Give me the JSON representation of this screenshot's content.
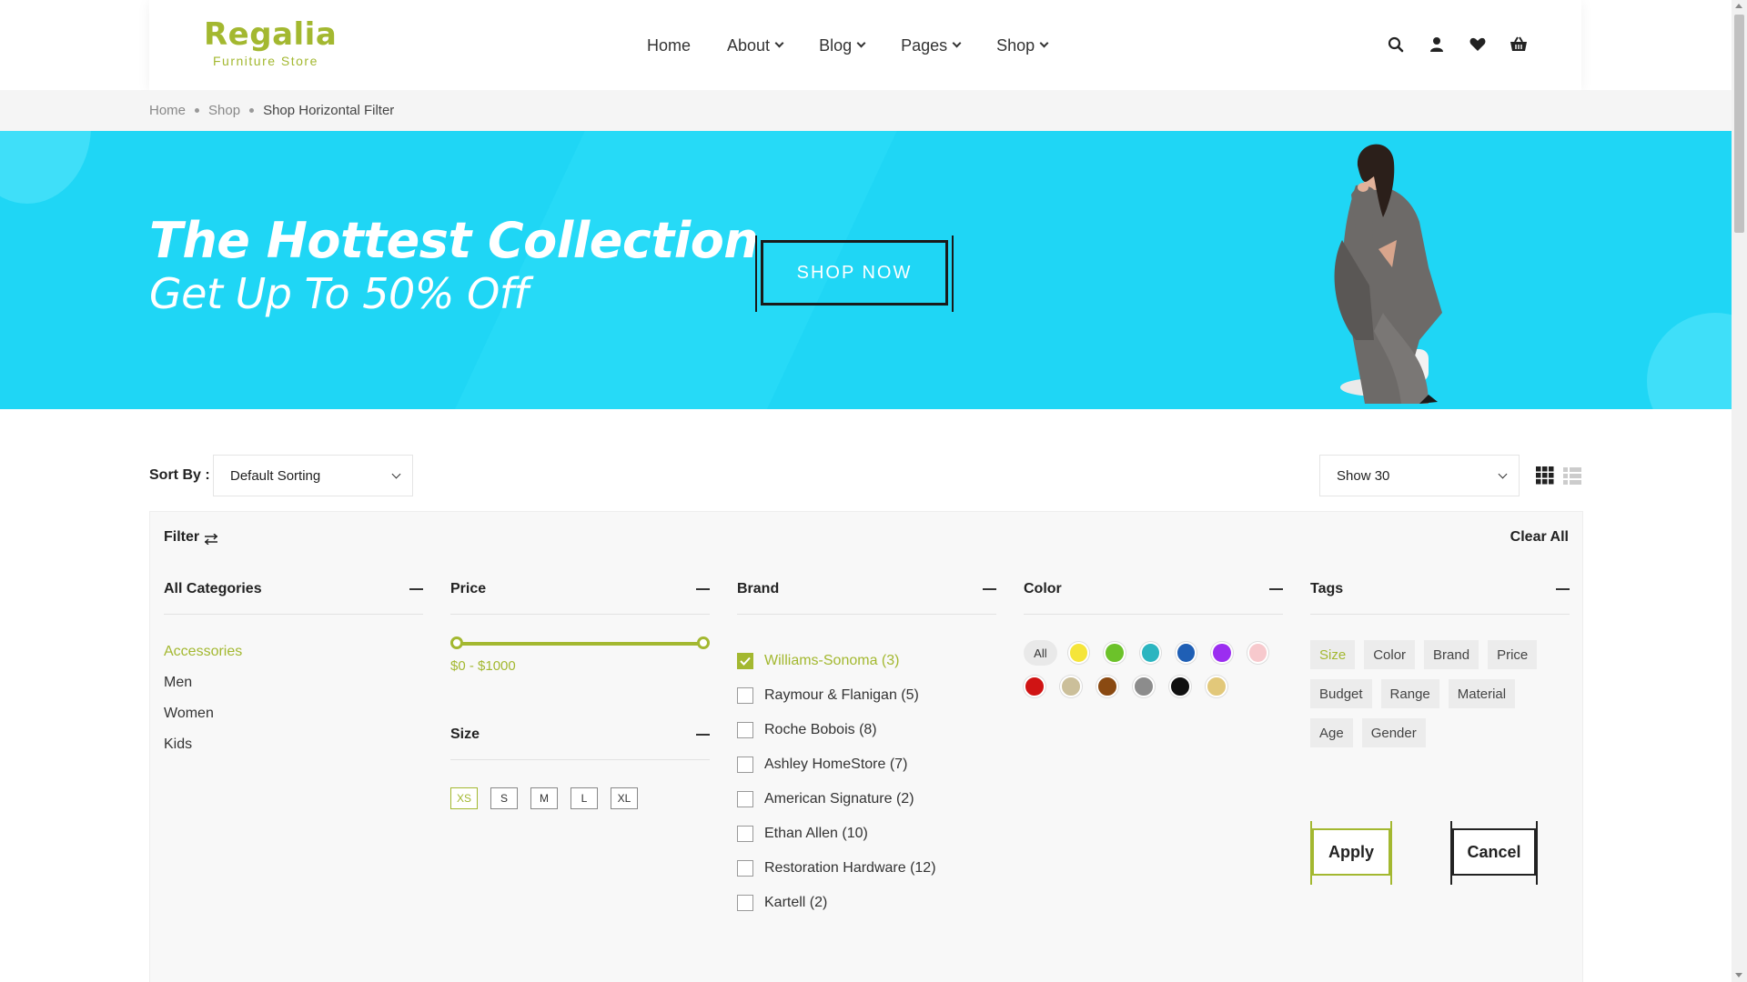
{
  "header": {
    "logo_title": "Regalia",
    "logo_subtitle": "Furniture Store",
    "nav": [
      {
        "label": "Home",
        "has_dropdown": false
      },
      {
        "label": "About",
        "has_dropdown": true
      },
      {
        "label": "Blog",
        "has_dropdown": true
      },
      {
        "label": "Pages",
        "has_dropdown": true
      },
      {
        "label": "Shop",
        "has_dropdown": true
      }
    ],
    "icons": [
      "search-icon",
      "user-icon",
      "heart-icon",
      "basket-icon"
    ]
  },
  "breadcrumb": {
    "items": [
      "Home",
      "Shop"
    ],
    "current": "Shop Horizontal Filter"
  },
  "hero": {
    "title": "The Hottest Collection",
    "subtitle": "Get Up To 50% Off",
    "button": "SHOP NOW"
  },
  "toolbar": {
    "sort_label": "Sort By :",
    "sort_value": "Default Sorting",
    "show_value": "Show 30"
  },
  "filter": {
    "title": "Filter",
    "clear_all": "Clear All",
    "categories": {
      "title": "All Categories",
      "items": [
        "Accessories",
        "Men",
        "Women",
        "Kids"
      ],
      "active": "Accessories"
    },
    "price": {
      "title": "Price",
      "range_text": "$0 - $1000",
      "min": 0,
      "max": 1000
    },
    "size": {
      "title": "Size",
      "options": [
        "XS",
        "S",
        "M",
        "L",
        "XL"
      ],
      "active": "XS"
    },
    "brand": {
      "title": "Brand",
      "items": [
        {
          "label": "Williams-Sonoma (3)",
          "checked": true
        },
        {
          "label": "Raymour & Flanigan (5)",
          "checked": false
        },
        {
          "label": "Roche Bobois (8)",
          "checked": false
        },
        {
          "label": "Ashley HomeStore (7)",
          "checked": false
        },
        {
          "label": "American Signature (2)",
          "checked": false
        },
        {
          "label": "Ethan Allen (10)",
          "checked": false
        },
        {
          "label": "Restoration Hardware (12)",
          "checked": false
        },
        {
          "label": "Kartell (2)",
          "checked": false
        }
      ]
    },
    "color": {
      "title": "Color",
      "all_label": "All",
      "row1": [
        "#f5e53a",
        "#6cc22a",
        "#2bb5c0",
        "#1f5fb5",
        "#9b2ef0",
        "#f7c9cd"
      ],
      "row2": [
        "#d01414",
        "#cbbf9a",
        "#8a4a12",
        "#8c8c8c",
        "#111111",
        "#e2c87a"
      ]
    },
    "tags": {
      "title": "Tags",
      "items": [
        "Size",
        "Color",
        "Brand",
        "Price",
        "Budget",
        "Range",
        "Material",
        "Age",
        "Gender"
      ],
      "active": "Size"
    },
    "apply_label": "Apply",
    "cancel_label": "Cancel"
  },
  "accent_color": "#a3b830",
  "hero_color": "#1fd6f5"
}
